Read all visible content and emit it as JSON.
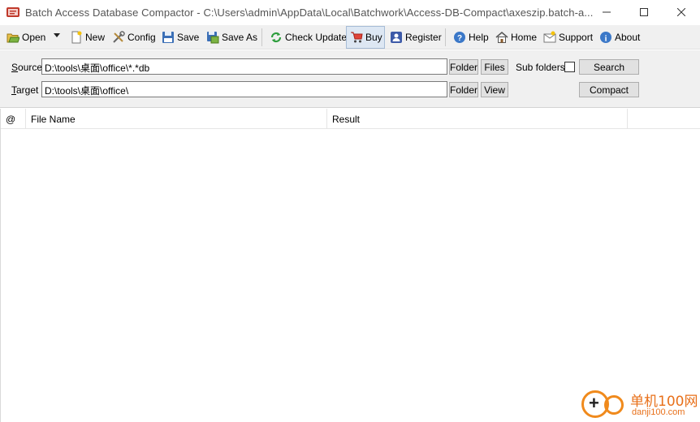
{
  "window": {
    "title": "Batch Access Database Compactor - C:\\Users\\admin\\AppData\\Local\\Batchwork\\Access-DB-Compact\\axeszip.batch-a..."
  },
  "toolbar": {
    "open": "Open",
    "new": "New",
    "config": "Config",
    "save": "Save",
    "save_as": "Save As",
    "check_update": "Check Update",
    "buy": "Buy",
    "register": "Register",
    "help": "Help",
    "home": "Home",
    "support": "Support",
    "about": "About"
  },
  "source": {
    "label_accel": "S",
    "label_rest": "ource",
    "value": "D:\\tools\\桌面\\office\\*.*db",
    "folder_button": "Folder",
    "files_button": "Files",
    "subfolders_label": "Sub folders",
    "subfolders_checked": false,
    "search_button": "Search"
  },
  "target": {
    "label_accel": "T",
    "label_rest": "arget",
    "value": "D:\\tools\\桌面\\office\\",
    "folder_button": "Folder",
    "view_button": "View",
    "compact_button": "Compact"
  },
  "list": {
    "columns": [
      "@",
      "File Name",
      "Result"
    ],
    "rows": []
  },
  "watermark": {
    "text_cn": "单机100网",
    "text_url": "danji100.com"
  },
  "colors": {
    "toolbar_bg": "#f0f0f0",
    "active_button_bg": "#dde7f3",
    "watermark_orange": "#e8701a"
  }
}
